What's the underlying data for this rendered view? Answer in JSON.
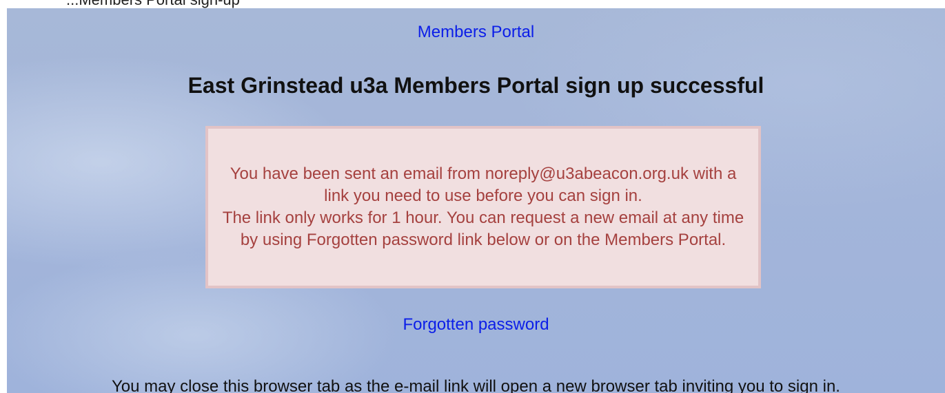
{
  "header_fragment": "...Members Portal sign-up",
  "nav": {
    "members_portal": "Members Portal"
  },
  "page": {
    "title": "East Grinstead u3a Members Portal sign up successful"
  },
  "notice": {
    "paragraph_1": "You have been sent an email from noreply@u3abeacon.org.uk with a link you need to use before you can sign in.",
    "paragraph_2": "The link only works for 1 hour. You can request a new email at any time by using Forgotten password link below or on the Members Portal."
  },
  "links": {
    "forgotten_password": "Forgotten password"
  },
  "footer": {
    "close_tab_note": "You may close this browser tab as the e-mail link will open a new browser tab inviting you to sign in."
  },
  "colors": {
    "link": "#0b1ee8",
    "notice_text": "#a5413f",
    "notice_background": "#f1dfe0",
    "notice_border": "#e2c3c6",
    "page_background": "#a7b8d8"
  }
}
